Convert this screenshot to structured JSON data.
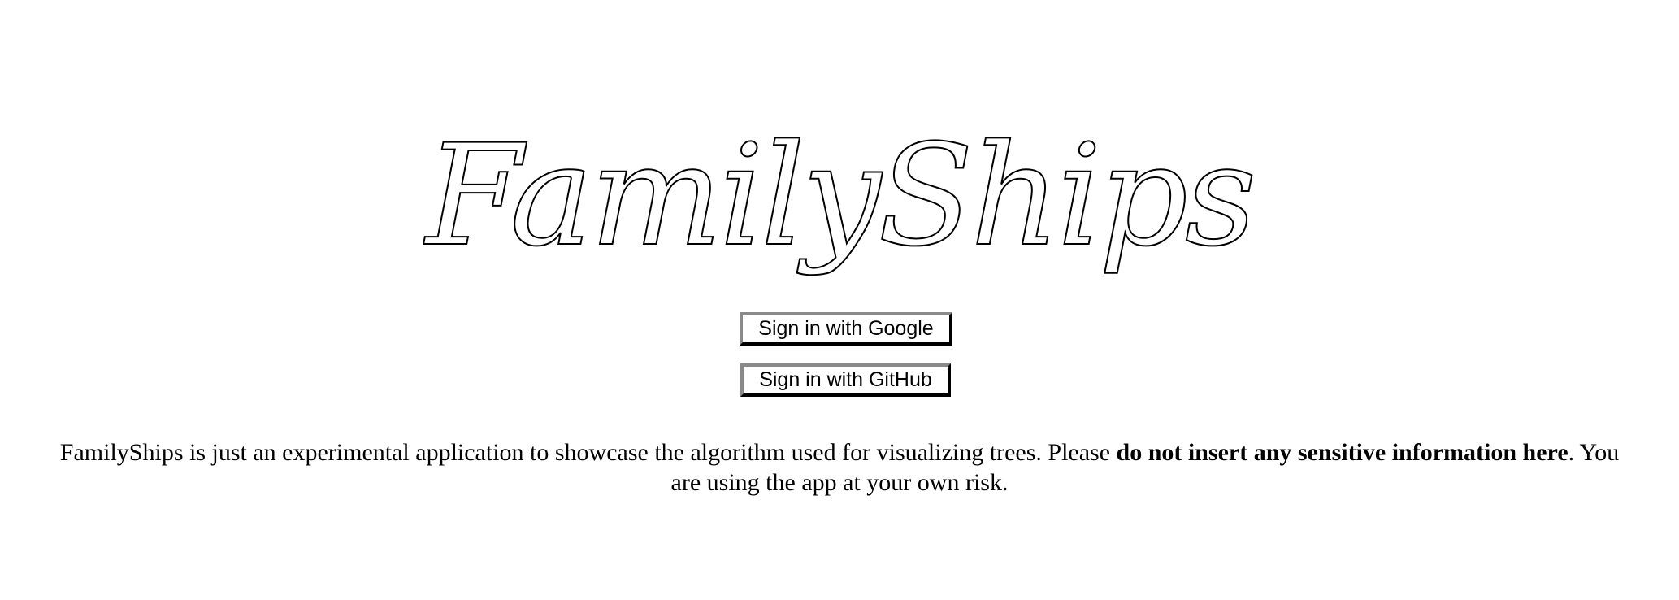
{
  "logo": {
    "text": "FamilyShips"
  },
  "auth": {
    "google_label": "Sign in with Google",
    "github_label": "Sign in with GitHub"
  },
  "disclaimer": {
    "intro": "FamilyShips is just an experimental application to showcase the algorithm used for visualizing trees. Please ",
    "warning": "do not insert any sensitive information here",
    "outro": ". You are using the app at your own risk."
  },
  "colors": {
    "background": "#ffffff",
    "text": "#000000",
    "button_border_dark": "#3a3a3a",
    "button_border_light": "#8a8a8a"
  }
}
